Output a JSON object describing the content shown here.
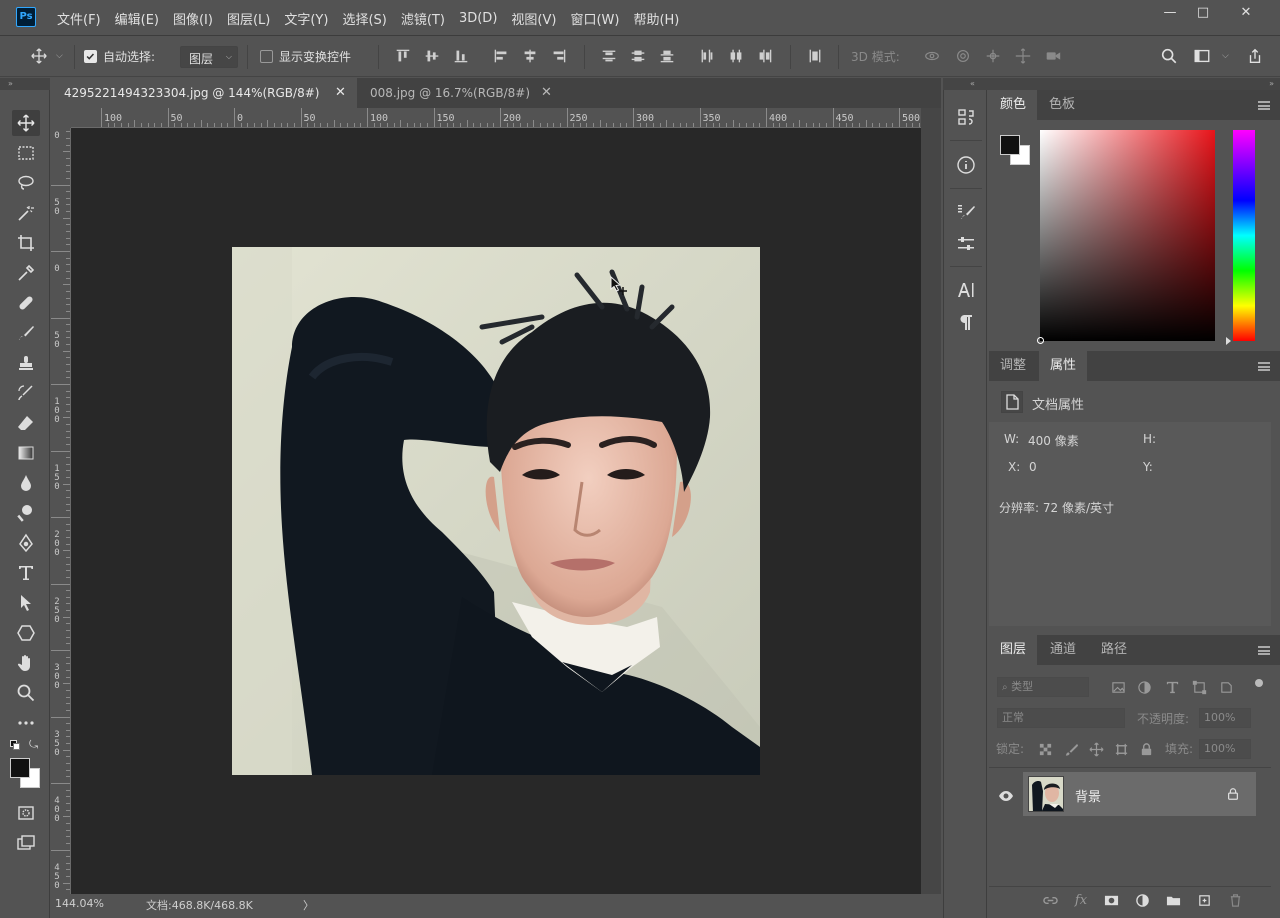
{
  "app": {
    "logo": "Ps"
  },
  "menu": [
    "文件(F)",
    "编辑(E)",
    "图像(I)",
    "图层(L)",
    "文字(Y)",
    "选择(S)",
    "滤镜(T)",
    "3D(D)",
    "视图(V)",
    "窗口(W)",
    "帮助(H)"
  ],
  "window_controls": {
    "minimize": "—",
    "maximize": "□",
    "close": "✕"
  },
  "options_bar": {
    "auto_select_label": "自动选择:",
    "auto_select_checked": true,
    "auto_select_target": "图层",
    "show_transform_label": "显示变换控件",
    "show_transform_checked": false,
    "mode_3d_label": "3D 模式:"
  },
  "tabs": [
    {
      "title": "4295221494323304.jpg @ 144%(RGB/8#)",
      "close": "✕",
      "active": true
    },
    {
      "title": "008.jpg @ 16.7%(RGB/8#)",
      "close": "✕",
      "active": false
    }
  ],
  "ruler_h_labels": [
    "100",
    "50",
    "0",
    "50",
    "100",
    "150",
    "200",
    "250",
    "300",
    "350",
    "400",
    "450",
    "500"
  ],
  "ruler_v_labels": [
    "0",
    "5 0",
    "0",
    "5 0",
    "1 0 0",
    "1 5 0",
    "2 0 0",
    "2 5 0",
    "3 0 0",
    "3 5 0",
    "4 0 0",
    "4 5 0"
  ],
  "status": {
    "zoom": "144.04%",
    "doc": "文档:468.8K/468.8K",
    "arrow": "〉"
  },
  "color_panel": {
    "tabs": [
      "颜色",
      "色板"
    ],
    "foreground": "#111111",
    "background": "#ffffff",
    "hue_color": "#e8141a"
  },
  "properties_panel": {
    "tabs": [
      "调整",
      "属性"
    ],
    "title": "文档属性",
    "w_label": "W:",
    "w_value": "400 像素",
    "h_label": "H:",
    "x_label": "X:",
    "x_value": "0",
    "y_label": "Y:",
    "resolution": "分辨率: 72 像素/英寸"
  },
  "layers_panel": {
    "tabs": [
      "图层",
      "通道",
      "路径"
    ],
    "filter_placeholder": "类型",
    "blend_mode": "正常",
    "opacity_label": "不透明度:",
    "opacity_value": "100%",
    "lock_label": "锁定:",
    "fill_label": "填充:",
    "fill_value": "100%",
    "layers": [
      {
        "name": "背景",
        "visible": true,
        "locked": true
      }
    ]
  }
}
